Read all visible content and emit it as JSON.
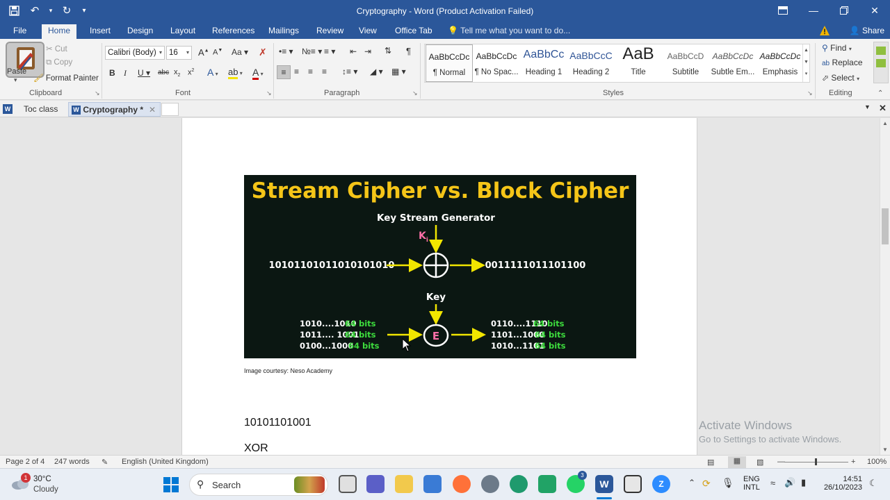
{
  "titlebar": {
    "title": "Cryptography - Word (Product Activation Failed)"
  },
  "ribbon_tabs": [
    "File",
    "Home",
    "Insert",
    "Design",
    "Layout",
    "References",
    "Mailings",
    "Review",
    "View",
    "Office Tab"
  ],
  "tell_me": "Tell me what you want to do...",
  "share": "Share",
  "clipboard": {
    "paste": "Paste",
    "cut": "Cut",
    "copy": "Copy",
    "format_painter": "Format Painter",
    "label": "Clipboard"
  },
  "font": {
    "name": "Calibri (Body)",
    "size": "16",
    "label": "Font"
  },
  "paragraph": {
    "label": "Paragraph"
  },
  "styles": {
    "label": "Styles",
    "items": [
      {
        "sample": "AaBbCcDc",
        "name": "¶ Normal"
      },
      {
        "sample": "AaBbCcDc",
        "name": "¶ No Spac..."
      },
      {
        "sample": "AaBbCc",
        "name": "Heading 1"
      },
      {
        "sample": "AaBbCcC",
        "name": "Heading 2"
      },
      {
        "sample": "AaB",
        "name": "Title"
      },
      {
        "sample": "AaBbCcD",
        "name": "Subtitle"
      },
      {
        "sample": "AaBbCcDc",
        "name": "Subtle Em..."
      },
      {
        "sample": "AaBbCcDc",
        "name": "Emphasis"
      }
    ]
  },
  "editing": {
    "find": "Find",
    "replace": "Replace",
    "select": "Select",
    "label": "Editing"
  },
  "doc_tabs": [
    "Toc class",
    "Cryptography *"
  ],
  "figure": {
    "title": "Stream Cipher vs. Block Cipher",
    "key_stream_generator": "Key Stream Generator",
    "ki": "K",
    "ki_sub": "i",
    "stream_in": "10101101011010101010",
    "stream_out": "0011111011101100",
    "key": "Key",
    "e": "E",
    "block_in": [
      {
        "bits": "1010....1010",
        "size": "64 bits"
      },
      {
        "bits": "1011.... 1001",
        "size": "64 bits"
      },
      {
        "bits": "0100...1000",
        "size": "64 bits"
      }
    ],
    "block_out": [
      {
        "bits": "0110....1110",
        "size": "64 bits"
      },
      {
        "bits": "1101...1000",
        "size": "64 bits"
      },
      {
        "bits": "1010...1101",
        "size": "64 bits"
      }
    ]
  },
  "caption": "Image courtesy: Neso Academy",
  "body_lines": [
    "10101101001",
    "XOR"
  ],
  "activate": {
    "line1": "Activate Windows",
    "line2": "Go to Settings to activate Windows."
  },
  "status": {
    "page": "Page 2 of 4",
    "words": "247 words",
    "language": "English (United Kingdom)",
    "zoom": "100%"
  },
  "taskbar": {
    "temp": "30°C",
    "weather": "Cloudy",
    "weather_badge": "1",
    "search": "Search",
    "lang1": "ENG",
    "lang2": "INTL",
    "time": "14:51",
    "date": "26/10/2023",
    "whatsapp_badge": "3"
  },
  "colors": {
    "word_blue": "#2b579a",
    "figure_bg": "#0b1712",
    "title_yellow": "#f5c518",
    "arrow_yellow": "#f2e600",
    "bits_green": "#3ddc3d",
    "ki_pink": "#ff6fa8"
  }
}
